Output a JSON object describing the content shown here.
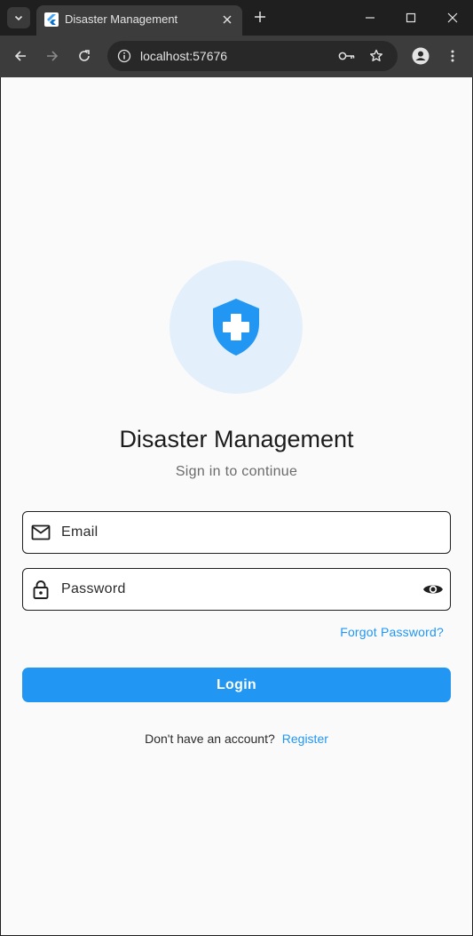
{
  "browser": {
    "tab": {
      "title": "Disaster Management",
      "favicon": "flutter-icon"
    },
    "address_bar": {
      "url": "localhost:57676"
    },
    "icons": {
      "tab_search": "chevron-down-icon",
      "tab_close": "close-icon",
      "new_tab": "plus-icon",
      "minimize": "minimize-icon",
      "maximize": "maximize-icon",
      "window_close": "close-icon",
      "back": "arrow-left-icon",
      "forward": "arrow-right-icon",
      "reload": "reload-icon",
      "site_info": "info-icon",
      "password_key": "key-icon",
      "bookmark": "star-icon",
      "profile": "profile-icon",
      "menu": "kebab-menu-icon"
    }
  },
  "login": {
    "logo_icon": "shield-plus-icon",
    "title": "Disaster Management",
    "subtitle": "Sign in to continue",
    "email": {
      "placeholder": "Email",
      "value": "",
      "icon": "mail-icon"
    },
    "password": {
      "placeholder": "Password",
      "value": "",
      "icon": "lock-icon",
      "toggle_icon": "eye-icon"
    },
    "forgot_password": "Forgot Password?",
    "login_button": "Login",
    "register_prompt": "Don't have an account?",
    "register_link": "Register"
  },
  "colors": {
    "primary": "#2196f3",
    "logo_background": "#e3f0fc",
    "page_background": "#fafafa",
    "browser_frame": "#1f1f1f",
    "browser_toolbar": "#3c3c3c"
  }
}
